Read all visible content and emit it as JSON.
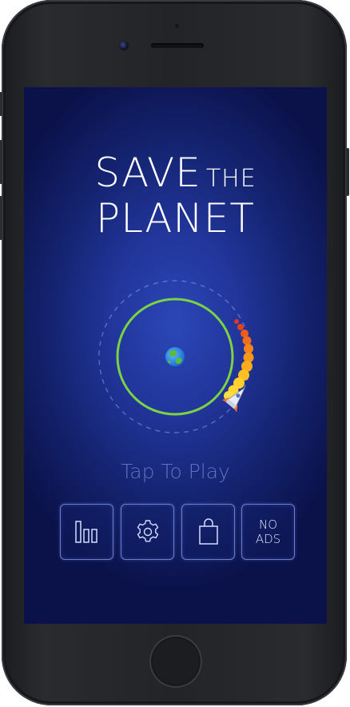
{
  "device": {
    "frame_color": "#232427",
    "icons": [
      "front-camera-icon",
      "earpiece-speaker-icon",
      "home-button-icon"
    ]
  },
  "game": {
    "title_line1": "SAVE",
    "title_line1_small": "THE",
    "title_line2": "PLANET",
    "tap_prompt": "Tap To Play",
    "colors": {
      "background": "#2b47b8",
      "orbit": "#7bd243",
      "title": "#ffffff",
      "tap_text": "#5f72c2",
      "button_border": "#7891e1"
    },
    "scene": {
      "planet_icon": "earth-icon",
      "orbit_icon": "orbit-ring",
      "rocket_icon": "rocket-icon"
    },
    "buttons": [
      {
        "icon": "leaderboard-icon",
        "label": ""
      },
      {
        "icon": "settings-gear-icon",
        "label": ""
      },
      {
        "icon": "shopping-bag-icon",
        "label": ""
      },
      {
        "icon": "no-ads-icon",
        "label_line1": "NO",
        "label_line2": "ADS"
      }
    ]
  }
}
